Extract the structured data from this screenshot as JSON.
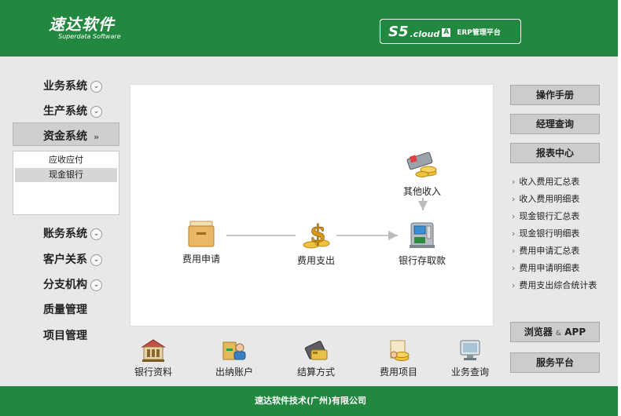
{
  "header": {
    "brand_name": "速达软件",
    "brand_sub": "Superdata Software",
    "product_s5": "S5",
    "product_cloud": ".cloud",
    "product_a": "A",
    "product_desc": "ERP管理平台"
  },
  "nav": {
    "items": [
      {
        "label": "业务系统",
        "chevron": "⌄"
      },
      {
        "label": "生产系统",
        "chevron": "⌄"
      },
      {
        "label": "资金系统",
        "chevron": "»"
      },
      {
        "label": "账务系统",
        "chevron": "⌄"
      },
      {
        "label": "客户关系",
        "chevron": "⌄"
      },
      {
        "label": "分支机构",
        "chevron": "⌄"
      },
      {
        "label": "质量管理",
        "chevron": ""
      },
      {
        "label": "项目管理",
        "chevron": ""
      }
    ],
    "subitems": [
      {
        "label": "应收应付"
      },
      {
        "label": "现金银行"
      }
    ]
  },
  "flow": {
    "nodes": [
      {
        "label": "费用申请",
        "icon": "folder-icon"
      },
      {
        "label": "费用支出",
        "icon": "money-icon"
      },
      {
        "label": "银行存取款",
        "icon": "atm-icon"
      },
      {
        "label": "其他收入",
        "icon": "coins-icon"
      }
    ]
  },
  "bottom": {
    "items": [
      {
        "label": "银行资料",
        "icon": "bank-icon"
      },
      {
        "label": "出纳账户",
        "icon": "cashier-icon"
      },
      {
        "label": "结算方式",
        "icon": "payment-icon"
      },
      {
        "label": "费用项目",
        "icon": "expense-icon"
      },
      {
        "label": "业务查询",
        "icon": "query-icon"
      }
    ]
  },
  "right": {
    "buttons": [
      {
        "label": "操作手册"
      },
      {
        "label": "经理查询"
      },
      {
        "label": "报表中心"
      }
    ],
    "reports": [
      "收入费用汇总表",
      "收入费用明细表",
      "现金银行汇总表",
      "现金银行明细表",
      "费用申请汇总表",
      "费用申请明细表",
      "费用支出综合统计表"
    ],
    "bottom_buttons": [
      {
        "label_main": "浏览器",
        "label_amp": "&",
        "label_tail": "APP"
      },
      {
        "label": "服务平台"
      }
    ]
  },
  "footer": {
    "text": "速达软件技术(广州)有限公司"
  },
  "colors": {
    "brand_green": "#22883f",
    "panel_gray": "#e8e8e8",
    "button_gray": "#cccccc"
  }
}
